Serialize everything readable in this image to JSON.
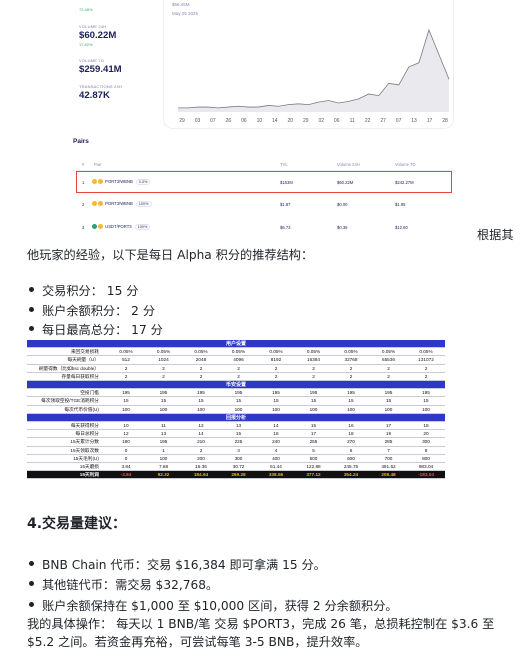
{
  "stats": {
    "pct_top": "72.48%",
    "volume_label": "VOLUME 24H",
    "volume_value": "$60.22M",
    "volume_pct": "17.82%",
    "volume7d_label": "VOLUME 7D",
    "volume7d_value": "$259.41M",
    "tx_label": "TRANSACTIONS 24H",
    "tx_value": "42.87K"
  },
  "chart": {
    "price": "$56.45M",
    "date": "May 25 2025",
    "x_ticks": [
      "29",
      "03",
      "07",
      "26",
      "06",
      "10",
      "14",
      "20",
      "29",
      "02",
      "06",
      "11",
      "22",
      "27",
      "07",
      "13",
      "17",
      "28"
    ],
    "series": [
      5,
      5,
      6,
      6,
      5,
      6,
      7,
      6,
      6,
      8,
      7,
      9,
      10,
      9,
      12,
      14,
      11,
      13,
      16,
      22,
      20,
      35,
      33,
      55,
      60,
      100,
      70,
      40
    ]
  },
  "pairs": {
    "title": "Pairs",
    "headers": {
      "num": "#",
      "pair": "Pair",
      "tvl": "TVL",
      "vol24": "Volume 24H",
      "vol7d": "Volume 7D"
    },
    "rows": [
      {
        "num": "1",
        "pair": "PORT3/WBNB",
        "fee": "0.0%",
        "tvl": "$153M",
        "vol24": "$60.22M",
        "vol7d": "$242.27M",
        "c1": "#f3ba2f",
        "c2": "#f3ba2f"
      },
      {
        "num": "2",
        "pair": "PORT3/WBNB",
        "fee": "100%",
        "tvl": "$1.87",
        "vol24": "$0.00",
        "vol7d": "$1.95",
        "c1": "#f3ba2f",
        "c2": "#f3ba2f"
      },
      {
        "num": "3",
        "pair": "USDT/PORT3",
        "fee": "100%",
        "tvl": "$6.73",
        "vol24": "$0.35",
        "vol7d": "$12.60",
        "c1": "#26a17b",
        "c2": "#f3ba2f"
      }
    ]
  },
  "text": {
    "intro_tail": "根据其",
    "intro": "他玩家的经验，以下是每日 Alpha 积分的推荐结构：",
    "bullets1": [
      "交易积分： 15 分",
      "账户余额积分： 2 分",
      "每日最高总分： 17 分"
    ],
    "heading": "4.交易量建议：",
    "bullets2": [
      "BNB Chain 代币：交易 $16,384 即可拿满 15 分。",
      "其他链代币：需交易 $32,768。",
      "账户余额保持在 $1,000 至 $10,000 区间，获得 2 分余额积分。"
    ],
    "para1": "我的具体操作： 每天以 1 BNB/笔 交易 $PORT3，完成 26 笔，总损耗控制在 $3.6 至",
    "para2": "$5.2 之间。若资金再充裕，可尝试每笔 3-5 BNB，提升效率。"
  },
  "sheet": {
    "sections": [
      "用户设置",
      "币安设置",
      "回报分析"
    ],
    "rows_a": [
      {
        "label": "来回交易损耗",
        "cells": [
          "0.05%",
          "0.05%",
          "0.05%",
          "0.05%",
          "0.05%",
          "0.05%",
          "0.05%",
          "0.05%",
          "0.05%"
        ]
      },
      {
        "label": "每天刷量（U）",
        "cells": [
          "512",
          "1024",
          "2048",
          "4096",
          "8192",
          "16384",
          "32768",
          "65536",
          "131072"
        ]
      },
      {
        "label": "刷量得数（比如bsc double）",
        "cells": [
          "2",
          "2",
          "2",
          "2",
          "2",
          "2",
          "2",
          "2",
          "2"
        ]
      },
      {
        "label": "存量每日获取积分",
        "cells": [
          "2",
          "2",
          "2",
          "2",
          "2",
          "2",
          "2",
          "2",
          "2"
        ]
      }
    ],
    "rows_b": [
      {
        "label": "空投门槛",
        "cells": [
          "195",
          "195",
          "195",
          "195",
          "195",
          "195",
          "195",
          "195",
          "195"
        ]
      },
      {
        "label": "每次领取空投/TGE消耗积分",
        "cells": [
          "15",
          "15",
          "15",
          "15",
          "15",
          "15",
          "15",
          "15",
          "15"
        ]
      },
      {
        "label": "每次代币价值(U)",
        "cells": [
          "100",
          "100",
          "100",
          "100",
          "100",
          "100",
          "100",
          "100",
          "100"
        ]
      }
    ],
    "rows_c": [
      {
        "label": "每天获得积分",
        "cells": [
          "10",
          "11",
          "12",
          "13",
          "14",
          "15",
          "16",
          "17",
          "18"
        ]
      },
      {
        "label": "每日总积分",
        "cells": [
          "12",
          "13",
          "14",
          "15",
          "16",
          "17",
          "18",
          "19",
          "20"
        ]
      },
      {
        "label": "15天累计分数",
        "cells": [
          "180",
          "195",
          "210",
          "225",
          "240",
          "255",
          "270",
          "285",
          "300"
        ]
      },
      {
        "label": "15天领取次数",
        "cells": [
          "0",
          "1",
          "2",
          "3",
          "4",
          "5",
          "6",
          "7",
          "8"
        ]
      },
      {
        "label": "15天毛利(U)",
        "cells": [
          "0",
          "100",
          "200",
          "300",
          "400",
          "500",
          "600",
          "700",
          "800"
        ]
      },
      {
        "label": "15天磨损",
        "cells": [
          "3.84",
          "7.68",
          "15.36",
          "30.72",
          "61.44",
          "122.88",
          "245.76",
          "491.52",
          "983.04"
        ]
      }
    ],
    "last_row": {
      "label": "15天利润",
      "cells": [
        "-3.84",
        "92.32",
        "184.64",
        "269.28",
        "338.56",
        "377.12",
        "354.24",
        "208.48",
        "-183.04"
      ]
    }
  }
}
